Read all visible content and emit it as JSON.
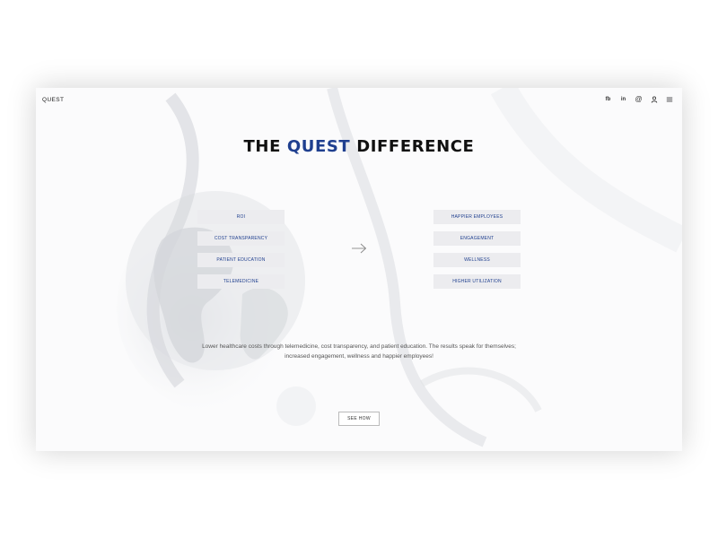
{
  "header": {
    "brand": "QUEST",
    "icons": [
      {
        "name": "facebook-icon",
        "glyph": "fb"
      },
      {
        "name": "linkedin-icon",
        "glyph": "in"
      },
      {
        "name": "email-icon",
        "glyph": "@"
      },
      {
        "name": "user-icon",
        "glyph": "user"
      },
      {
        "name": "menu-icon",
        "glyph": "menu"
      }
    ]
  },
  "hero": {
    "title_prefix": "THE ",
    "title_accent": "QUEST",
    "title_suffix": " DIFFERENCE"
  },
  "left_items": [
    "ROI",
    "COST TRANSPARENCY",
    "PATIENT EDUCATION",
    "TELEMEDICINE"
  ],
  "right_items": [
    "HAPPIER EMPLOYEES",
    "ENGAGEMENT",
    "WELLNESS",
    "HIGHER UTILIZATION"
  ],
  "description": "Lower healthcare costs through telemedicine, cost transparency, and patient education. The results speak for themselves; increased engagement, wellness and happier employees!",
  "cta": {
    "label": "SEE HOW"
  },
  "colors": {
    "accent": "#1f3f8f",
    "pill_bg": "#ececef",
    "text": "#111111"
  }
}
